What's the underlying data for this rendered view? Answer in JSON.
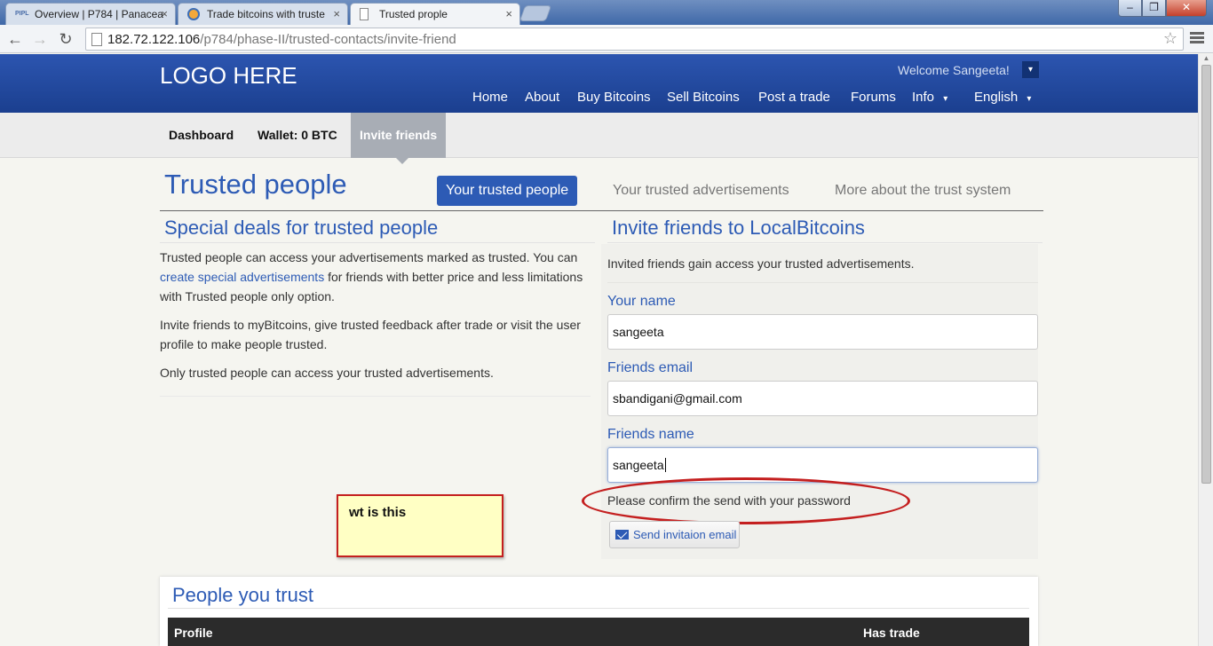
{
  "browser": {
    "tabs": [
      {
        "label": "Overview | P784 | Panacea",
        "icon": "pipl-favicon"
      },
      {
        "label": "Trade bitcoins with truste",
        "icon": "bitcoin-favicon"
      },
      {
        "label": "Trusted prople",
        "icon": "page-favicon"
      }
    ],
    "tab_icon_text": "PIPL",
    "url_host": "182.72.122.106",
    "url_path": "/p784/phase-II/trusted-contacts/invite-friend"
  },
  "header": {
    "logo": "LOGO HERE",
    "welcome": "Welcome Sangeeta!",
    "nav": [
      "Home",
      "About",
      "Buy Bitcoins",
      "Sell Bitcoins",
      "Post a trade",
      "Forums",
      "Info",
      "English"
    ]
  },
  "subnav": {
    "dashboard": "Dashboard",
    "wallet": "Wallet: 0 BTC",
    "invite": "Invite friends"
  },
  "page": {
    "title": "Trusted people",
    "tabs": [
      "Your trusted people",
      "Your trusted advertisements",
      "More about the trust system"
    ]
  },
  "left": {
    "heading": "Special deals for trusted people",
    "p1_before": "Trusted people can access your advertisements marked as trusted. You can ",
    "p1_link": "create special advertisements",
    "p1_after": " for friends with better price and less limitations with Trusted people only option.",
    "p2": "Invite friends to myBitcoins, give trusted feedback after trade or visit the user profile to make people trusted.",
    "p3": "Only trusted people can access your trusted advertisements."
  },
  "form": {
    "heading": "Invite friends to LocalBitcoins",
    "intro": "Invited friends gain access your trusted advertisements.",
    "your_name_label": "Your name",
    "your_name_value": "sangeeta",
    "friends_email_label": "Friends email",
    "friends_email_value": "sbandigani@gmail.com",
    "friends_name_label": "Friends name",
    "friends_name_value": "sangeeta",
    "confirm_text": "Please confirm the send with your password",
    "send_button": "Send invitaion email"
  },
  "annotation": {
    "note": "wt is this",
    "color": "#c41f1f"
  },
  "people": {
    "heading": "People you trust",
    "columns": [
      "Profile",
      "Has trade"
    ]
  }
}
